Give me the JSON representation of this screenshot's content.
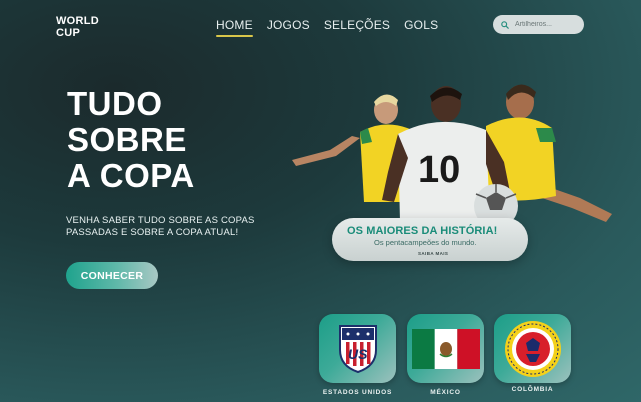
{
  "brand": {
    "line1": "WORLD",
    "line2": "CUP"
  },
  "nav": {
    "items": [
      {
        "label": "HOME",
        "active": true
      },
      {
        "label": "JOGOS",
        "active": false
      },
      {
        "label": "SELEÇÕES",
        "active": false
      },
      {
        "label": "GOLS",
        "active": false
      }
    ]
  },
  "search": {
    "placeholder": "Artilheiros..."
  },
  "hero": {
    "headline": [
      "TUDO",
      "SOBRE",
      "A COPA"
    ],
    "subtext_line1": "VENHA SABER TUDO SOBRE AS COPAS",
    "subtext_line2": "PASSADAS E SOBRE A COPA ATUAL!",
    "cta_label": "CONHECER"
  },
  "art": {
    "jersey_number": "10"
  },
  "feature_card": {
    "title": "OS MAIORES DA HISTÓRIA!",
    "subtitle": "Os pentacampeões do mundo.",
    "link": "SAIBA MAIS"
  },
  "teams": [
    {
      "name": "ESTADOS UNIDOS",
      "icon": "usa-crest-icon"
    },
    {
      "name": "MÉXICO",
      "icon": "mexico-flag-icon"
    },
    {
      "name": "COLÔMBIA",
      "icon": "colombia-crest-icon"
    }
  ],
  "colors": {
    "accent": "#1fa38d",
    "nav_underline": "#d8c64a",
    "card_title": "#1a8c79"
  }
}
